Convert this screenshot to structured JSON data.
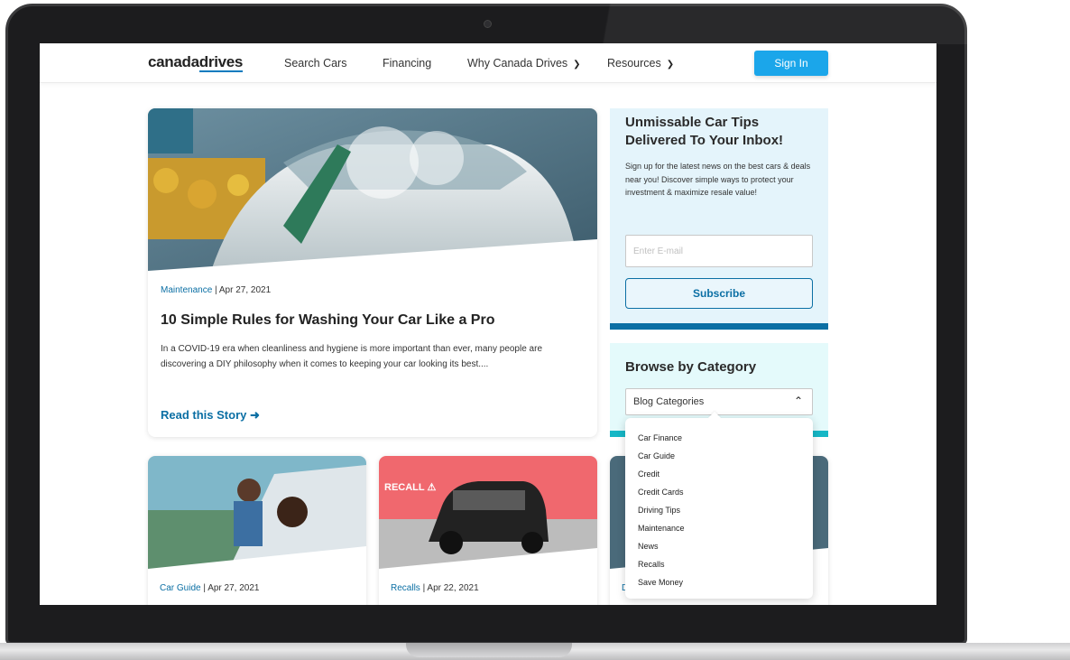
{
  "nav": {
    "logo_main": "canada",
    "logo_accent": "drives",
    "links": [
      "Search Cars",
      "Financing",
      "Why Canada Drives",
      "Resources"
    ],
    "signin_label": "Sign In"
  },
  "featured": {
    "category": "Maintenance",
    "separator": " | ",
    "date": "Apr 27, 2021",
    "title": "10 Simple Rules for Washing Your Car Like a Pro",
    "excerpt": "In a COVID-19 era when cleanliness and hygiene is more important than ever, many people are discovering a DIY philosophy when it comes to keeping your car looking its best....",
    "read_label": "Read this Story"
  },
  "cards": [
    {
      "category": "Car Guide",
      "date": "Apr 27, 2021"
    },
    {
      "category": "Recalls",
      "date": "Apr 22, 2021",
      "tag": "RECALL"
    },
    {
      "category": "D",
      "date": ""
    }
  ],
  "newsletter": {
    "title": "Unmissable Car Tips Delivered To Your Inbox!",
    "text": "Sign up for the latest news on the best cars & deals near you! Discover simple ways to protect your investment & maximize resale value!",
    "email_placeholder": "Enter E-mail",
    "subscribe_label": "Subscribe"
  },
  "browse": {
    "title": "Browse by Category",
    "select_label": "Blog Categories",
    "options": [
      "Car Finance",
      "Car Guide",
      "Credit",
      "Credit Cards",
      "Driving Tips",
      "Maintenance",
      "News",
      "Recalls",
      "Save Money"
    ]
  },
  "icons": {
    "arrow": "arrow-right-icon",
    "chevron_down": "chevron-down-icon",
    "chevron_up": "chevron-up-icon",
    "warning": "warning-icon"
  },
  "colors": {
    "brand_blue": "#0b6fa4",
    "signin_blue": "#1ba6ea",
    "newsletter_bg": "#e4f4fb",
    "browse_accent": "#16b7c6",
    "recall_bg": "#f0686e"
  }
}
